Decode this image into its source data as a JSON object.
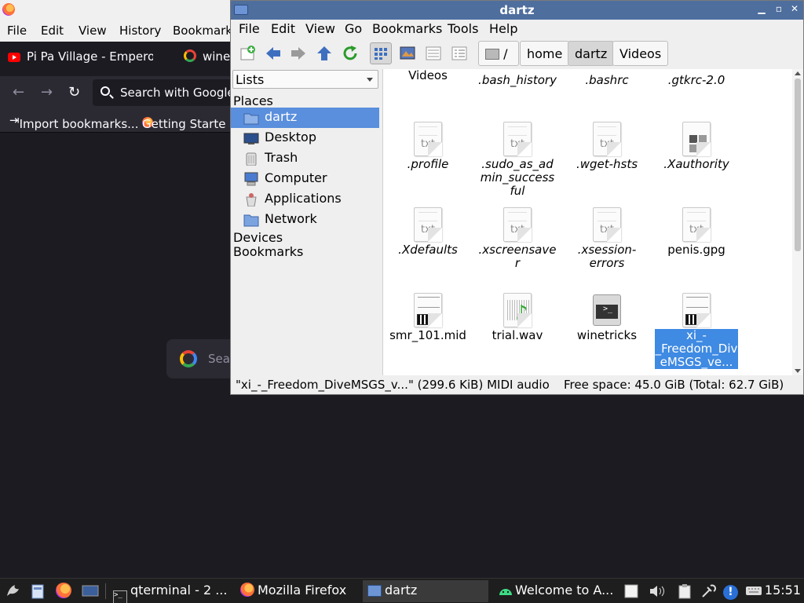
{
  "firefox": {
    "menus": [
      "File",
      "Edit",
      "View",
      "History",
      "Bookmarks"
    ],
    "tabs": [
      {
        "label": "Pi Pa Village - Emperor: R",
        "icon": "youtube-icon"
      },
      {
        "label": "wine-",
        "icon": "google-icon"
      }
    ],
    "search_placeholder": "Search with Google",
    "bookmarks": [
      {
        "label": "Import bookmarks...",
        "icon": "import-icon"
      },
      {
        "label": "Getting Starte",
        "icon": "firefox-icon"
      }
    ],
    "newtab_search_placeholder": "Sear"
  },
  "filemanager": {
    "title": "dartz",
    "menus": [
      "File",
      "Edit",
      "View",
      "Go",
      "Bookmarks",
      "Tools",
      "Help"
    ],
    "breadcrumbs": [
      "/",
      "home",
      "dartz",
      "Videos"
    ],
    "active_crumb": "dartz",
    "sidebar": {
      "dropdown": "Lists",
      "places_header": "Places",
      "places": [
        {
          "label": "dartz",
          "icon": "home-folder-icon",
          "selected": true
        },
        {
          "label": "Desktop",
          "icon": "desktop-icon",
          "selected": false
        },
        {
          "label": "Trash",
          "icon": "trash-icon",
          "selected": false
        },
        {
          "label": "Computer",
          "icon": "computer-icon",
          "selected": false
        },
        {
          "label": "Applications",
          "icon": "applications-icon",
          "selected": false
        },
        {
          "label": "Network",
          "icon": "network-icon",
          "selected": false
        }
      ],
      "devices_header": "Devices",
      "bookmarks_header": "Bookmarks"
    },
    "files": [
      {
        "name": "Videos",
        "type": "folder",
        "hidden": false
      },
      {
        "name": ".bash_history",
        "type": "text",
        "hidden": true
      },
      {
        "name": ".bashrc",
        "type": "text",
        "hidden": true
      },
      {
        "name": ".gtkrc-2.0",
        "type": "text",
        "hidden": true
      },
      {
        "name": ".profile",
        "type": "txt",
        "hidden": true
      },
      {
        "name": ".sudo_as_admin_successful",
        "type": "txt",
        "hidden": true
      },
      {
        "name": ".wget-hsts",
        "type": "txt",
        "hidden": true
      },
      {
        "name": ".Xauthority",
        "type": "xauth",
        "hidden": true
      },
      {
        "name": ".Xdefaults",
        "type": "txt",
        "hidden": true
      },
      {
        "name": ".xscreensaver",
        "type": "txt",
        "hidden": true
      },
      {
        "name": ".xsession-errors",
        "type": "txt",
        "hidden": true
      },
      {
        "name": "penis.gpg",
        "type": "txt",
        "hidden": false
      },
      {
        "name": "smr_101.mid",
        "type": "midi",
        "hidden": false
      },
      {
        "name": "trial.wav",
        "type": "wav",
        "hidden": false
      },
      {
        "name": "winetricks",
        "type": "script",
        "hidden": false
      },
      {
        "name": "xi_-_Freedom_DiveMSGS_ve...",
        "type": "midi",
        "hidden": false,
        "selected": true
      }
    ],
    "status_selection": "\"xi_-_Freedom_DiveMSGS_v...\" (299.6 KiB) MIDI audio",
    "status_space": "Free space: 45.0 GiB (Total: 62.7 GiB)",
    "ext_label": "txt"
  },
  "taskbar": {
    "tasks": [
      {
        "label": "qterminal - 2 ...",
        "icon": "terminal-icon"
      },
      {
        "label": "Mozilla Firefox",
        "icon": "firefox-icon"
      },
      {
        "label": "dartz",
        "icon": "folder-icon",
        "active": true
      },
      {
        "label": "Welcome to A...",
        "icon": "android-icon"
      }
    ],
    "clock": "15:51"
  }
}
